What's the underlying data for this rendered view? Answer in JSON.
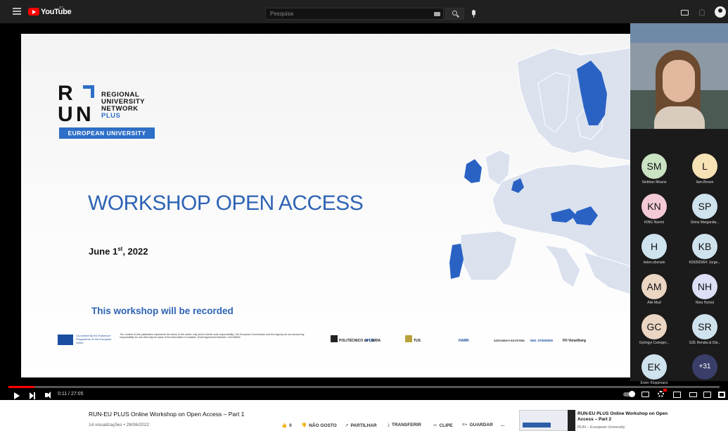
{
  "header": {
    "logo_text": "YouTube",
    "region": "PT",
    "search_placeholder": "Pesquisa"
  },
  "slide": {
    "logo_lines": [
      "REGIONAL",
      "UNIVERSITY",
      "NETWORK"
    ],
    "logo_plus": "PLUS",
    "logo_letters": [
      "R",
      "U",
      "N"
    ],
    "european_university": "EUROPEAN UNIVERSITY",
    "title": "WORKSHOP OPEN ACCESS",
    "date": "June 1",
    "date_suffix": "st",
    "date_year": ", 2022",
    "recorded_notice": "This workshop will be recorded",
    "funding_text": "Co-funded by the Erasmus+ Programme of the European Union",
    "disclaimer": "The content of this publication represents the views of the author only and is his/her sole responsibility. The European Commission and the Agency do not accept any responsibility for use that may be made of the information it contains. Grant Agreement Number: 101035816",
    "partners": [
      "POLITÉCNICO de LEIRIA",
      "IPCA",
      "TUS",
      "HAMK",
      "SZÉCHENYI EGYETEM",
      "NHL STENDEN",
      "FH Vorarlberg"
    ]
  },
  "participants": [
    {
      "initials": "SM",
      "name": "Siobhan Moane",
      "color": "#c9e3c3"
    },
    {
      "initials": "L",
      "name": "liam.Brown",
      "color": "#f6e2b5"
    },
    {
      "initials": "KN",
      "name": "KING Naomi",
      "color": "#f4cad6"
    },
    {
      "initials": "SP",
      "name": "Sónia Margarida...",
      "color": "#cfe3ee"
    },
    {
      "initials": "H",
      "name": "helen.sherwin",
      "color": "#cfe3ee"
    },
    {
      "initials": "KB",
      "name": "K00265964: Jorge...",
      "color": "#cfe3ee"
    },
    {
      "initials": "AM",
      "name": "Alie Mud",
      "color": "#ebd5c3"
    },
    {
      "initials": "NH",
      "name": "Nina Hynnä",
      "color": "#dcdff5"
    },
    {
      "initials": "GC",
      "name": "Gyöngyi Csenger...",
      "color": "#ebd5c3"
    },
    {
      "initials": "SR",
      "name": "SZE Renáta & Diá...",
      "color": "#cfe3ee"
    },
    {
      "initials": "EK",
      "name": "Erwin Kloppmans",
      "color": "#cfe3ee"
    },
    {
      "initials": "+31",
      "name": "",
      "color": "#3a3f6a"
    }
  ],
  "player": {
    "time_display": "0:11 / 27:05",
    "progress_fraction": 0.0068
  },
  "video": {
    "title": "RUN-EU PLUS Online Workshop on Open Access – Part 1",
    "meta": "14 visualizações • 28/06/2022",
    "actions": {
      "like_count": "0",
      "dislike": "NÃO GOSTO",
      "share": "PARTILHAR",
      "download": "TRANSFERIR",
      "clip": "CLIPE",
      "save": "GUARDAR",
      "more": "..."
    }
  },
  "recommended": {
    "title": "RUN-EU PLUS Online Workshop on Open Access – Part 2",
    "channel": "RUN – European University"
  },
  "colors": {
    "accent_red": "#ff0000",
    "slide_blue": "#2e63b4",
    "map_highlight": "#2a62c4",
    "map_base": "#dbe2ee"
  }
}
